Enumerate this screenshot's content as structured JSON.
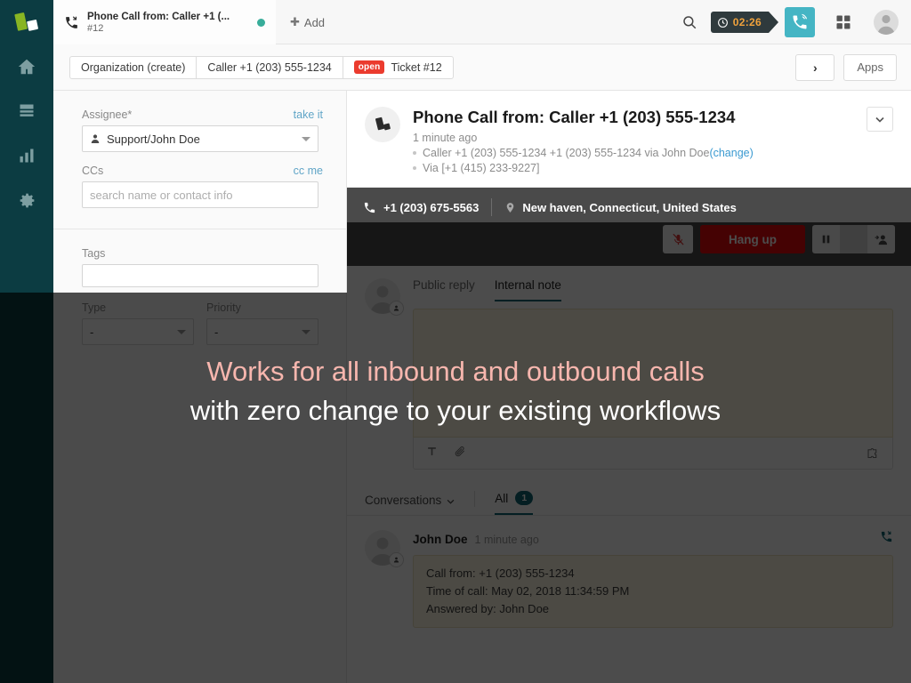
{
  "app": {
    "logo_name": "zammad-logo",
    "rail_items": [
      {
        "name": "home-icon",
        "label": "Home"
      },
      {
        "name": "overviews-icon",
        "label": "Overviews"
      },
      {
        "name": "reporting-icon",
        "label": "Reporting"
      },
      {
        "name": "settings-gear-icon",
        "label": "Settings"
      }
    ]
  },
  "topbar": {
    "tab": {
      "title": "Phone Call from: Caller +1 (...",
      "subtitle": "#12",
      "icon": "incoming-call-icon",
      "state_dot_color": "#38ad9a"
    },
    "add_label": "Add",
    "search_icon": "search-icon",
    "timer": {
      "value": "02:26",
      "icon": "clock-icon"
    },
    "call_button_icon": "phone-ringing-icon",
    "grid_icon": "grid-apps-icon",
    "avatar_icon": "user-avatar-icon"
  },
  "subheader": {
    "breadcrumbs": [
      {
        "label": "Organization (create)",
        "badge": null
      },
      {
        "label": "Caller +1 (203) 555-1234",
        "badge": null
      },
      {
        "label": "Ticket #12",
        "badge": "open"
      }
    ],
    "next_label": "›",
    "apps_label": "Apps"
  },
  "form": {
    "assignee": {
      "label": "Assignee*",
      "action": "take it",
      "value": "Support/John Doe"
    },
    "ccs": {
      "label": "CCs",
      "action": "cc me",
      "placeholder": "search name or contact info",
      "value": ""
    },
    "tags": {
      "label": "Tags",
      "value": ""
    },
    "type": {
      "label": "Type",
      "value": "-"
    },
    "priority": {
      "label": "Priority",
      "value": "-"
    }
  },
  "ticket": {
    "title": "Phone Call from: Caller +1 (203) 555-1234",
    "time": "1 minute ago",
    "meta_line1_text": "Caller +1 (203) 555-1234 +1 (203) 555-1234 via John Doe ",
    "meta_line1_link": "(change)",
    "meta_line2": "Via [+1 (415) 233-9227]",
    "collapse_icon": "chevron-down-icon"
  },
  "call": {
    "phone_number": "+1 (203) 675-5563",
    "location": "New haven, Connecticut, United States",
    "phone_icon": "phone-icon",
    "location_icon": "map-pin-icon",
    "mute_icon": "microphone-muted-icon",
    "hangup_label": "Hang up",
    "pause_icon": "pause-icon",
    "add_person_icon": "add-person-icon"
  },
  "reply": {
    "tabs": [
      {
        "label": "Public reply",
        "active": false
      },
      {
        "label": "Internal note",
        "active": true
      }
    ],
    "note_value": "",
    "toolbar": {
      "text_format_icon": "text-format-icon",
      "attachment_icon": "paperclip-icon",
      "knowledge_base_icon": "puzzle-piece-icon"
    }
  },
  "conversations": {
    "selector_label": "Conversations",
    "selector_icon": "chevron-down-icon",
    "all_tab_label": "All",
    "all_tab_count": "1",
    "messages": [
      {
        "author": "John Doe",
        "time": "1 minute ago",
        "channel_icon": "incoming-call-icon",
        "lines": [
          "Call from: +1 (203) 555-1234",
          "Time of call: May 02, 2018 11:34:59 PM",
          "Answered by: John Doe"
        ]
      }
    ]
  },
  "caption": {
    "line1": "Works for all inbound and outbound calls",
    "line2": "with zero change to your existing workflows",
    "line1_color": "#f7b6ae",
    "line2_color": "#ffffff"
  }
}
